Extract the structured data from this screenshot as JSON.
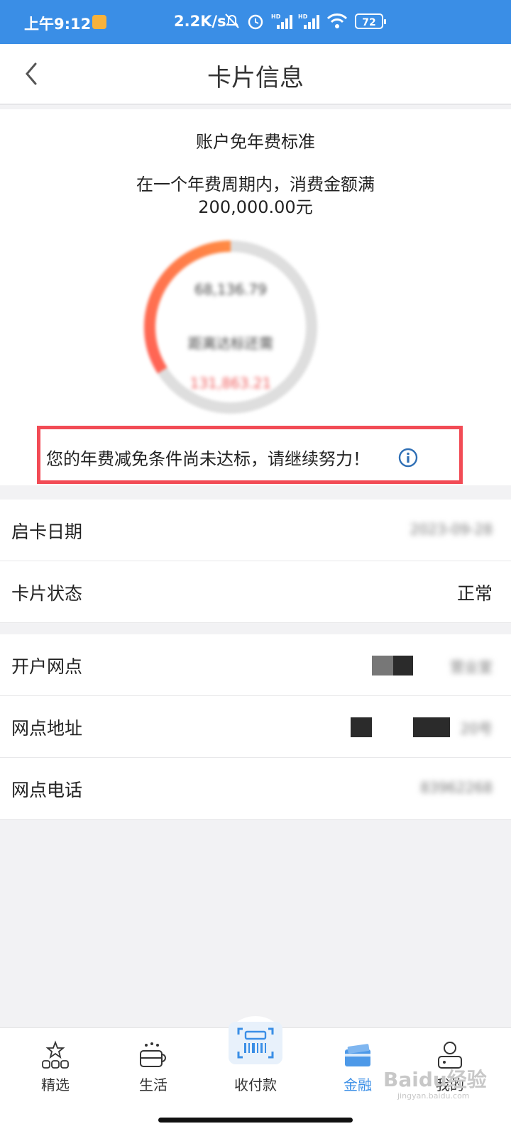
{
  "status_bar": {
    "time": "上午9:12",
    "speed": "2.2K/s",
    "battery": "72",
    "color": "#3a8ee6"
  },
  "nav": {
    "back_icon": "chevron-left-icon",
    "title": "卡片信息"
  },
  "fee_standard": {
    "title": "账户免年费标准",
    "description_line1": "在一个年费周期内，消费金额满",
    "description_line2": "200,000.00元",
    "progress_fraction": 0.34,
    "spent_amount": "68,136.79",
    "ring_label": "距离达标还需",
    "remaining_amount": "131,863.21",
    "alert_text": "您的年费减免条件尚未达标，请继续努力！",
    "alert_border_color": "#f24b55"
  },
  "card_rows": [
    {
      "label": "启卡日期",
      "value": "2023-09-28",
      "blurred": true
    },
    {
      "label": "卡片状态",
      "value": "正常",
      "blurred": false
    }
  ],
  "branch_rows": [
    {
      "label": "开户网点",
      "value": "营业室",
      "blurred": true
    },
    {
      "label": "网点地址",
      "value": "20号",
      "blurred": true
    },
    {
      "label": "网点电话",
      "value": "83962268",
      "blurred": true
    }
  ],
  "tabbar": {
    "tabs": [
      {
        "label": "精选",
        "icon": "star-blocks-icon"
      },
      {
        "label": "生活",
        "icon": "cup-icon"
      },
      {
        "label": "收付款",
        "icon": "scan-barcode-icon"
      },
      {
        "label": "金融",
        "icon": "card-icon",
        "active": true
      },
      {
        "label": "我的",
        "icon": "user-icon"
      }
    ],
    "active_color": "#3a8ee6"
  },
  "watermark": {
    "text": "Baidu经验",
    "sub": "jingyan.baidu.com"
  }
}
